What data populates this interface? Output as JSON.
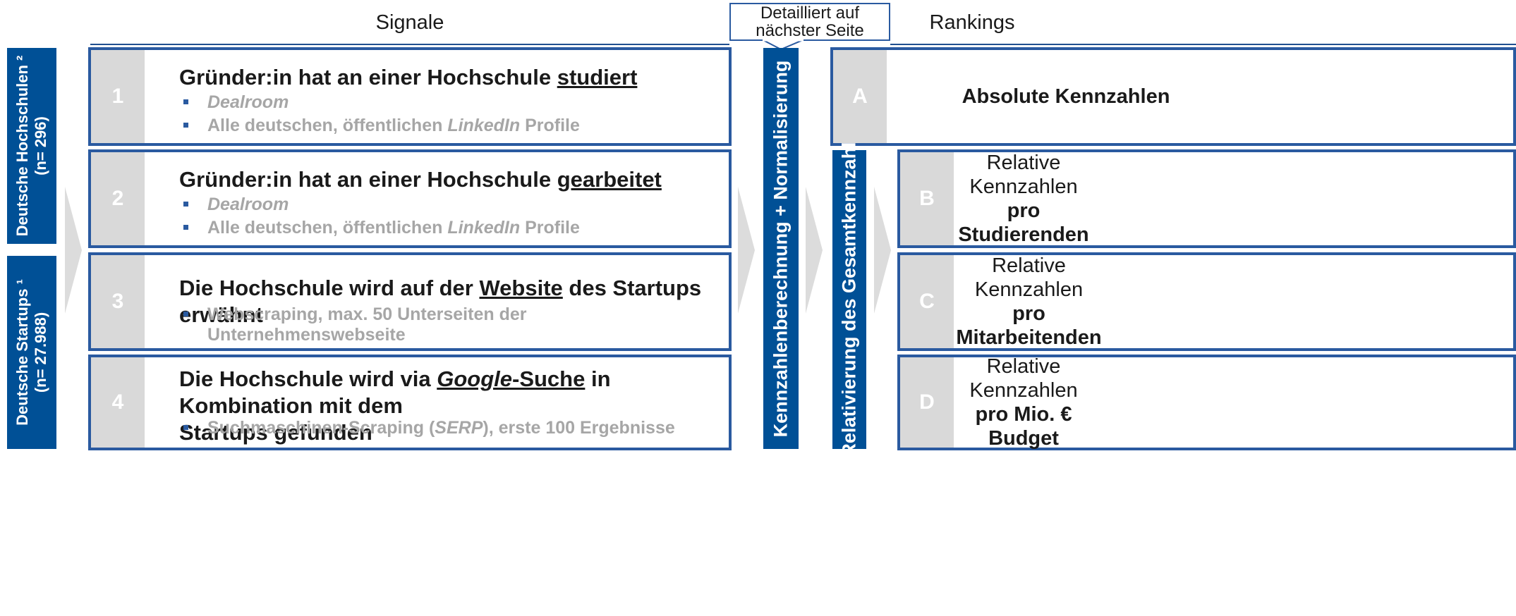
{
  "headers": {
    "signale": "Signale",
    "detail_line1": "Detailliert auf",
    "detail_line2": "nächster Seite",
    "rankings": "Rankings"
  },
  "left_labels": {
    "hochschulen_line1": "Deutsche Hochschulen ²",
    "hochschulen_line2": "(n= 296)",
    "startups_line1": "Deutsche Startups ¹",
    "startups_line2": "(n= 27.988)"
  },
  "signals": [
    {
      "number": "1",
      "title_pre": "Gründer:in hat an einer Hochschule ",
      "title_u": "studiert",
      "bullet1": "Dealroom",
      "bullet2_pre": "Alle deutschen, öffentlichen ",
      "bullet2_it": "LinkedIn",
      "bullet2_post": " Profile"
    },
    {
      "number": "2",
      "title_pre": "Gründer:in hat an einer Hochschule ",
      "title_u": "gearbeitet",
      "bullet1": "Dealroom",
      "bullet2_pre": "Alle deutschen, öffentlichen ",
      "bullet2_it": "LinkedIn",
      "bullet2_post": " Profile"
    },
    {
      "number": "3",
      "title_pre": "Die Hochschule wird auf der ",
      "title_u": "Website",
      "title_post": " des Startups erwähnt",
      "bullet1": "Webscraping, max. 50 Unterseiten der Unternehmenswebseite"
    },
    {
      "number": "4",
      "title_pre": "Die Hochschule wird via ",
      "title_u_it": "Google",
      "title_u": "-Suche",
      "title_post": " in Kombination mit dem",
      "title_line2": "Startups gefunden",
      "bullet1_pre": "Suchmaschinen-Scraping (",
      "bullet1_it": "SERP",
      "bullet1_post": "), erste 100 Ergebnisse"
    }
  ],
  "middle_bar": "Kennzahlenberechnung + Normalisierung",
  "relativ_bar": "Relativierung des Gesamtkennzahl",
  "rankings": [
    {
      "letter": "A",
      "bold": "Absolute Kennzahlen"
    },
    {
      "letter": "B",
      "line1": "Relative Kennzahlen",
      "bold": "pro Studierenden"
    },
    {
      "letter": "C",
      "line1": "Relative Kennzahlen",
      "bold": "pro Mitarbeitenden"
    },
    {
      "letter": "D",
      "line1": "Relative Kennzahlen",
      "bold": "pro Mio. € Budget"
    }
  ],
  "colors": {
    "accent": "#005096",
    "border": "#2a5aa0",
    "grey": "#d9d9d9",
    "bullet_text": "#a6a6a6"
  }
}
